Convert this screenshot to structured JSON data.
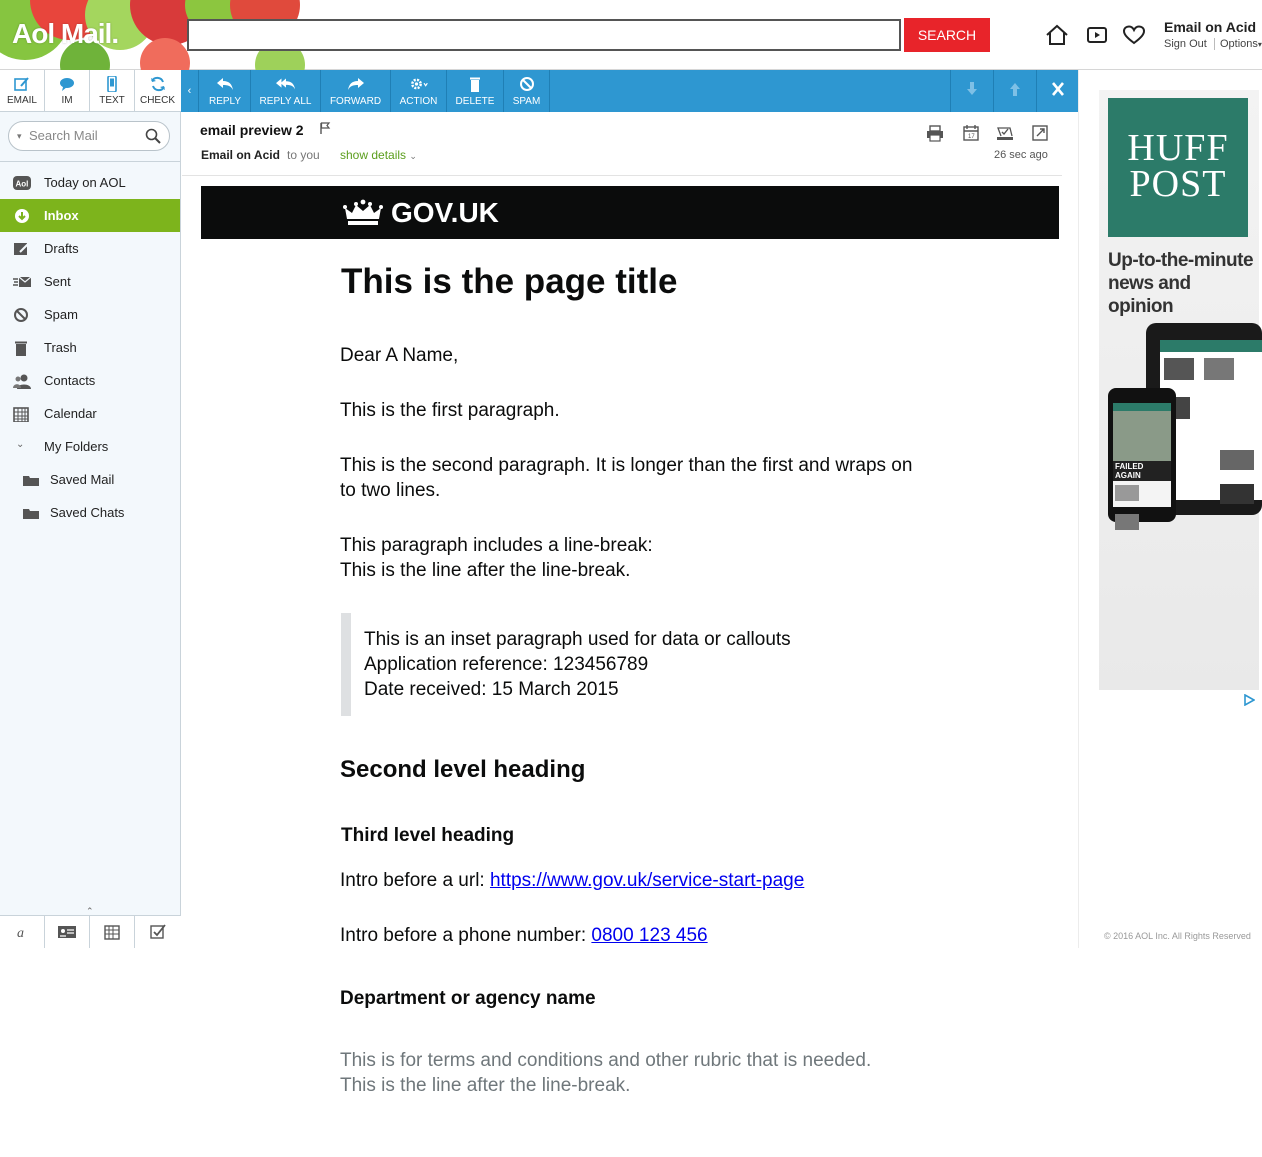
{
  "header": {
    "logo": "Aol Mail.",
    "search_placeholder": "",
    "search_button": "SEARCH",
    "account_name": "Email on Acid",
    "sign_out": "Sign Out",
    "options": "Options"
  },
  "leftnav": {
    "compose_buttons": [
      "EMAIL",
      "IM",
      "TEXT",
      "CHECK"
    ],
    "search_placeholder": "Search Mail",
    "items": [
      {
        "label": "Today on AOL"
      },
      {
        "label": "Inbox"
      },
      {
        "label": "Drafts"
      },
      {
        "label": "Sent"
      },
      {
        "label": "Spam"
      },
      {
        "label": "Trash"
      },
      {
        "label": "Contacts"
      },
      {
        "label": "Calendar"
      },
      {
        "label": "My Folders"
      },
      {
        "label": "Saved Mail"
      },
      {
        "label": "Saved Chats"
      }
    ]
  },
  "toolbar": {
    "reply": "REPLY",
    "reply_all": "REPLY ALL",
    "forward": "FORWARD",
    "action": "ACTION",
    "delete": "DELETE",
    "spam": "SPAM"
  },
  "message": {
    "subject": "email preview 2",
    "from": "Email on Acid",
    "to": "to you",
    "show_details": "show details",
    "time": "26 sec ago"
  },
  "email": {
    "govuk": "GOV.UK",
    "title": "This is the page title",
    "greeting": "Dear A Name,",
    "p1": "This is the first paragraph.",
    "p2_line1": "This is the second paragraph. It is longer than the first and wraps on",
    "p2_line2": "to two lines.",
    "p3_line1": "This paragraph includes a line-break:",
    "p3_line2": "This is the line after the line-break.",
    "inset_line1": "This is an inset paragraph used for data or callouts",
    "inset_line2": "Application reference: 123456789",
    "inset_line3": "Date received: 15 March 2015",
    "h2": "Second level heading",
    "h3": "Third level heading",
    "url_intro": "Intro before a url: ",
    "url": "https://www.gov.uk/service-start-page",
    "phone_intro": "Intro before a phone number: ",
    "phone": "0800 123 456",
    "dept": "Department or agency name",
    "rubric1": "This is for terms and conditions and other rubric that is needed.",
    "rubric2": "This is the line after the line-break."
  },
  "ad": {
    "brand_line1": "HUFF",
    "brand_line2": "POST",
    "tagline_line1": "Up-to-the-minute",
    "tagline_line2": "news and opinion",
    "phone_banner": "FAILED AGAIN",
    "copyright": "© 2016 AOL Inc. All Rights Reserved"
  },
  "colors": {
    "toolbar_blue": "#2e97d1",
    "nav_active_green": "#7db41c",
    "search_red": "#e8242a",
    "huffpost_green": "#2c7b69",
    "govuk_black": "#0b0c0c",
    "link_blue": "#0000ee"
  },
  "icons": [
    "home-icon",
    "video-icon",
    "heart-icon",
    "compose-icon",
    "chat-icon",
    "mobile-icon",
    "refresh-icon",
    "search-icon",
    "print-icon",
    "calendar-icon",
    "task-icon",
    "popout-icon",
    "flag-icon",
    "arrow-down-icon",
    "arrow-up-icon",
    "close-icon",
    "crown-icon",
    "adchoices-icon"
  ]
}
